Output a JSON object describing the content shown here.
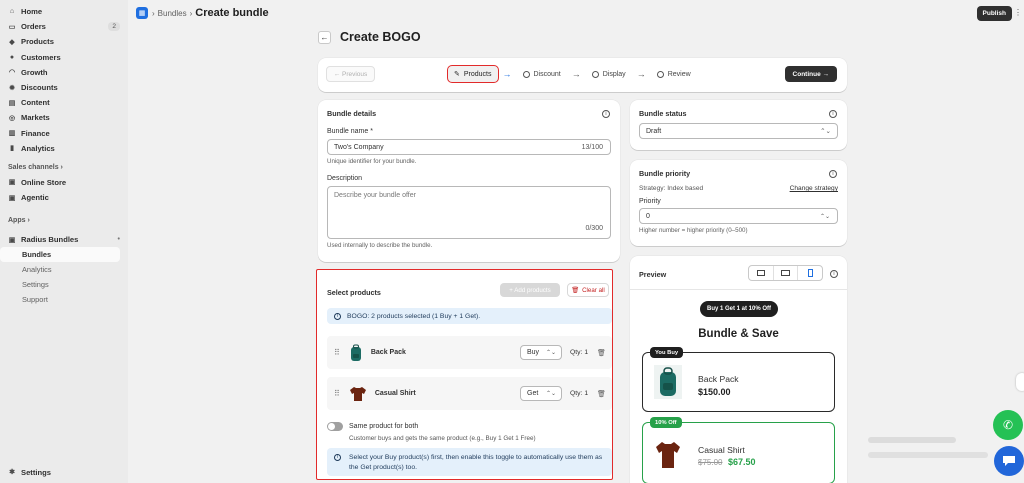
{
  "sidebar": {
    "items": [
      {
        "label": "Home",
        "icon": "home-icon",
        "glyph": "⌂"
      },
      {
        "label": "Orders",
        "icon": "orders-icon",
        "glyph": "▭",
        "badge": "2"
      },
      {
        "label": "Products",
        "icon": "tag-icon",
        "glyph": "◆"
      },
      {
        "label": "Customers",
        "icon": "person-icon",
        "glyph": "●"
      },
      {
        "label": "Growth",
        "icon": "growth-icon",
        "glyph": "◠"
      },
      {
        "label": "Discounts",
        "icon": "discount-icon",
        "glyph": "✹"
      },
      {
        "label": "Content",
        "icon": "content-icon",
        "glyph": "▤"
      },
      {
        "label": "Markets",
        "icon": "globe-icon",
        "glyph": "◎"
      },
      {
        "label": "Finance",
        "icon": "bank-icon",
        "glyph": "▥"
      },
      {
        "label": "Analytics",
        "icon": "chart-icon",
        "glyph": "▮"
      }
    ],
    "sales_channels_label": "Sales channels",
    "sales_channels": [
      {
        "label": "Online Store",
        "icon": "store-icon",
        "glyph": "▣"
      },
      {
        "label": "Agentic",
        "icon": "agentic-icon",
        "glyph": "▣"
      }
    ],
    "apps_label": "Apps",
    "app": {
      "label": "Radius Bundles",
      "icon": "app-icon",
      "glyph": "▣"
    },
    "app_subitems": [
      "Bundles",
      "Analytics",
      "Settings",
      "Support"
    ],
    "settings_label": "Settings"
  },
  "topbar": {
    "crumb": "Bundles",
    "title": "Create bundle",
    "publish_label": "Publish"
  },
  "page": {
    "title": "Create BOGO"
  },
  "stepper": {
    "prev_label": "← Previous",
    "steps": [
      "Products",
      "Discount",
      "Display",
      "Review"
    ],
    "continue_label": "Continue →"
  },
  "details": {
    "heading": "Bundle details",
    "name_label": "Bundle name *",
    "name_value": "Two's Company",
    "name_count": "13/100",
    "name_help": "Unique identifier for your bundle.",
    "desc_label": "Description",
    "desc_placeholder": "Describe your bundle offer",
    "desc_count": "0/300",
    "desc_help": "Used internally to describe the bundle."
  },
  "status": {
    "heading": "Bundle status",
    "value": "Draft"
  },
  "priority": {
    "heading": "Bundle priority",
    "strategy": "Strategy: Index based",
    "change_link": "Change strategy",
    "label": "Priority",
    "value": "0",
    "help": "Higher number = higher priority (0–500)"
  },
  "select_products": {
    "heading": "Select products",
    "add_label": "+ Add products",
    "clear_label": "Clear all",
    "banner": "BOGO: 2 products selected (1 Buy + 1 Get).",
    "rows": [
      {
        "name": "Back Pack",
        "role": "Buy",
        "qty": "Qty: 1"
      },
      {
        "name": "Casual Shirt",
        "role": "Get",
        "qty": "Qty: 1"
      }
    ],
    "toggle_label": "Same product for both",
    "toggle_help": "Customer buys and gets the same product (e.g., Buy 1 Get 1 Free)",
    "info_banner": "Select your Buy product(s) first, then enable this toggle to automatically use them as the Get product(s) too."
  },
  "preview": {
    "heading": "Preview",
    "offer_pill": "Buy 1 Get 1 at 10% Off",
    "bundle_title": "Bundle & Save",
    "buy_tag": "You Buy",
    "buy_name": "Back Pack",
    "buy_price": "$150.00",
    "get_tag": "10% Off",
    "get_name": "Casual Shirt",
    "get_old_price": "$75.00",
    "get_new_price": "$67.50"
  },
  "colors": {
    "accent": "#1f6fe0",
    "highlight": "#e22a2a",
    "success": "#27a14a",
    "dark": "#303030"
  }
}
